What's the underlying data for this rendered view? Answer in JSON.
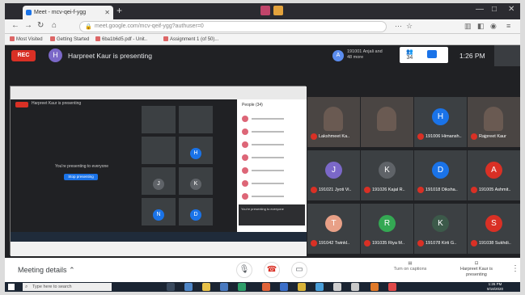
{
  "browser": {
    "tab_title": "Meet - mcv-qei-f-ygg",
    "new_tab": "+",
    "url": "meet.google.com/mcv-qeif-ygg?authuser=0",
    "window_controls": [
      "—",
      "□",
      "✕"
    ]
  },
  "bookmarks": [
    "Most Visited",
    "Getting Started",
    "6ba1b6d5.pdf - Unit..",
    "Assignment 1 (of 50)..."
  ],
  "meet": {
    "rec_label": "REC",
    "presenter_initial": "H",
    "presenter_text": "Harpreet Kaur is presenting",
    "pinned_initial": "A",
    "pinned_name": "191001 Anjali and 48 more",
    "participant_count": "34",
    "time": "1:26 PM"
  },
  "shared_screen": {
    "presenting_msg": "You're presenting to everyone",
    "stop_label": "Stop presenting",
    "panel_title": "People (34)",
    "toast": "You're presenting to everyone"
  },
  "tiles": [
    {
      "initial": "",
      "name": "Lakshmeet Ka..",
      "video": true,
      "color": ""
    },
    {
      "initial": "",
      "name": "",
      "video": true,
      "color": ""
    },
    {
      "initial": "H",
      "name": "191006 Himansh..",
      "video": false,
      "color": "#1a73e8"
    },
    {
      "initial": "",
      "name": "Rajpreet Kaur",
      "video": true,
      "color": ""
    },
    {
      "initial": "J",
      "name": "191021 Jyoti Vi..",
      "video": false,
      "color": "#7b68c8"
    },
    {
      "initial": "K",
      "name": "191026 Kajal R..",
      "video": false,
      "color": "#5f6368"
    },
    {
      "initial": "D",
      "name": "191018 Diksha..",
      "video": false,
      "color": "#1a73e8"
    },
    {
      "initial": "A",
      "name": "191005 Ashmit..",
      "video": false,
      "color": "#d93025"
    },
    {
      "initial": "T",
      "name": "191042 Twinkl..",
      "video": false,
      "color": "#e8a087"
    },
    {
      "initial": "R",
      "name": "191035 Riya M..",
      "video": false,
      "color": "#34a853"
    },
    {
      "initial": "K",
      "name": "191078 Kirti G..",
      "video": false,
      "color": "#3c5a4a"
    },
    {
      "initial": "S",
      "name": "191038 Sukhdi..",
      "video": false,
      "color": "#d93025"
    }
  ],
  "bottombar": {
    "details": "Meeting details",
    "captions": "Turn on captions",
    "present": "Harpreet Kaur is presenting",
    "more": "⋮"
  },
  "taskbar": {
    "search_placeholder": "Type here to search",
    "clock_time": "1:26 PM",
    "clock_date": "9/18/2020"
  }
}
